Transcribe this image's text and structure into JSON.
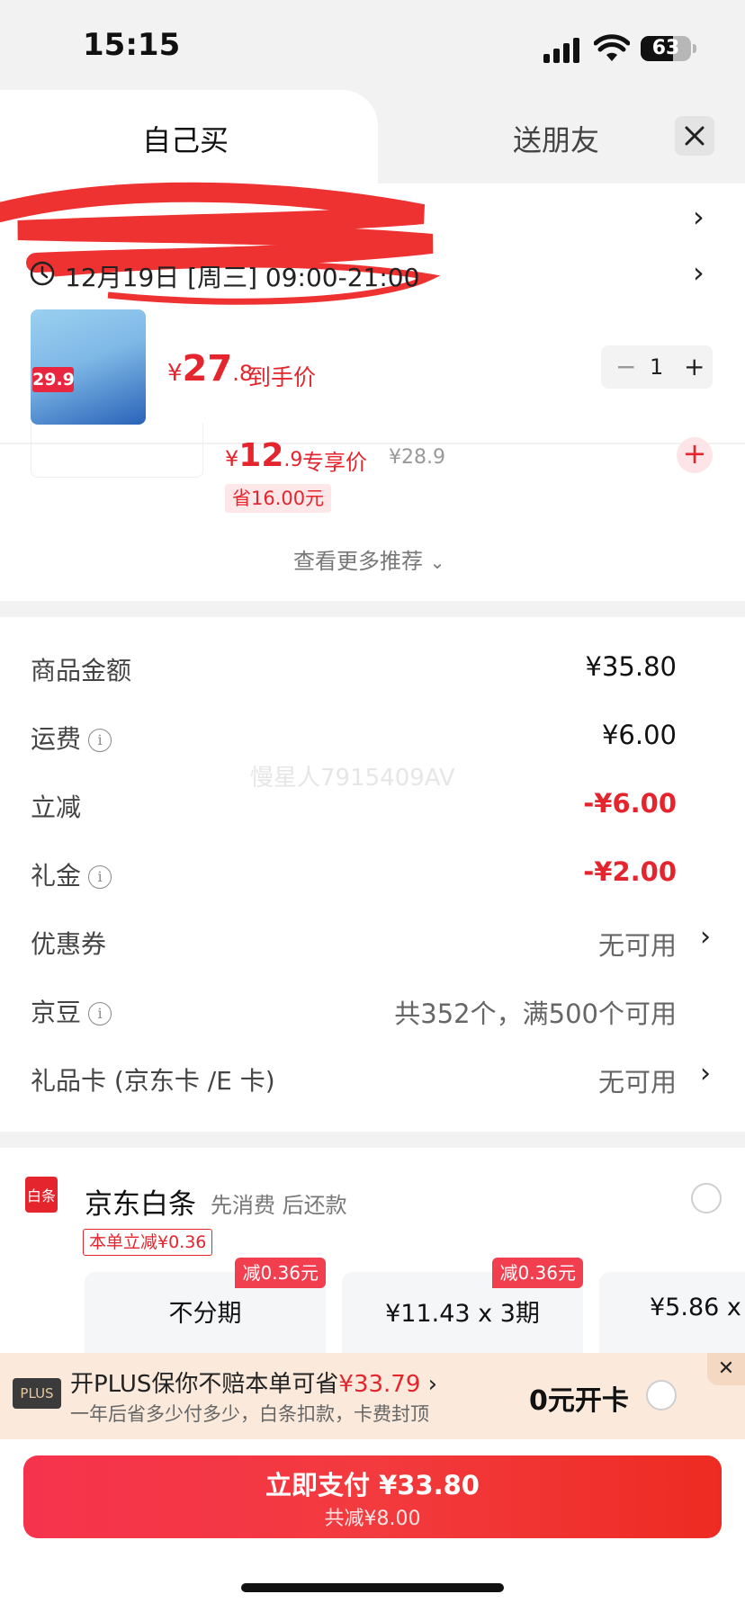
{
  "status_bar": {
    "time": "15:15",
    "battery": "63"
  },
  "tabs": {
    "active": "自己买",
    "other": "送朋友"
  },
  "delivery": {
    "time": "12月19日 [周三] 09:00-21:00"
  },
  "product": {
    "price_yen": "¥",
    "price_int": "27",
    "price_dec": ".8",
    "price_note": "到手价",
    "quantity": "1",
    "img_tag": "29.9"
  },
  "recommend": {
    "price_yen": "¥",
    "price_int": "12",
    "price_dec": ".9",
    "price_note": "专享价",
    "orig_price": "¥28.9",
    "save": "省16.00元",
    "more": "查看更多推荐"
  },
  "fees": {
    "goods_label": "商品金额",
    "goods_value": "¥35.80",
    "shipping_label": "运费",
    "shipping_value": "¥6.00",
    "discount_label": "立减",
    "discount_value": "-¥6.00",
    "gift_label": "礼金",
    "gift_value": "-¥2.00",
    "coupon_label": "优惠券",
    "coupon_value": "无可用",
    "jd_bean_label": "京豆",
    "jd_bean_value": "共352个，满500个可用",
    "giftcard_label": "礼品卡 (京东卡 /E 卡)",
    "giftcard_value": "无可用"
  },
  "watermark": "慢星人7915409AV",
  "baitiao": {
    "icon_text": "白条",
    "title": "京东白条",
    "subtitle": "先消费 后还款",
    "badge": "本单立减¥0.36",
    "plans": [
      {
        "label": "不分期",
        "badge": "减0.36元"
      },
      {
        "label": "¥11.43 x 3期",
        "badge": "减0.36元"
      },
      {
        "label": "¥5.86 x",
        "badge": ""
      }
    ]
  },
  "plus": {
    "logo": "PLUS",
    "title_pre": "开PLUS保你不赔本单可省",
    "title_amount": "¥33.79",
    "subtitle": "一年后省多少付多少，白条扣款，卡费封顶",
    "open": "0元开卡"
  },
  "pay": {
    "main": "立即支付 ¥33.80",
    "sub": "共减¥8.00"
  },
  "colors": {
    "accent": "#e4252d",
    "page_bg": "#f2f2f2"
  }
}
